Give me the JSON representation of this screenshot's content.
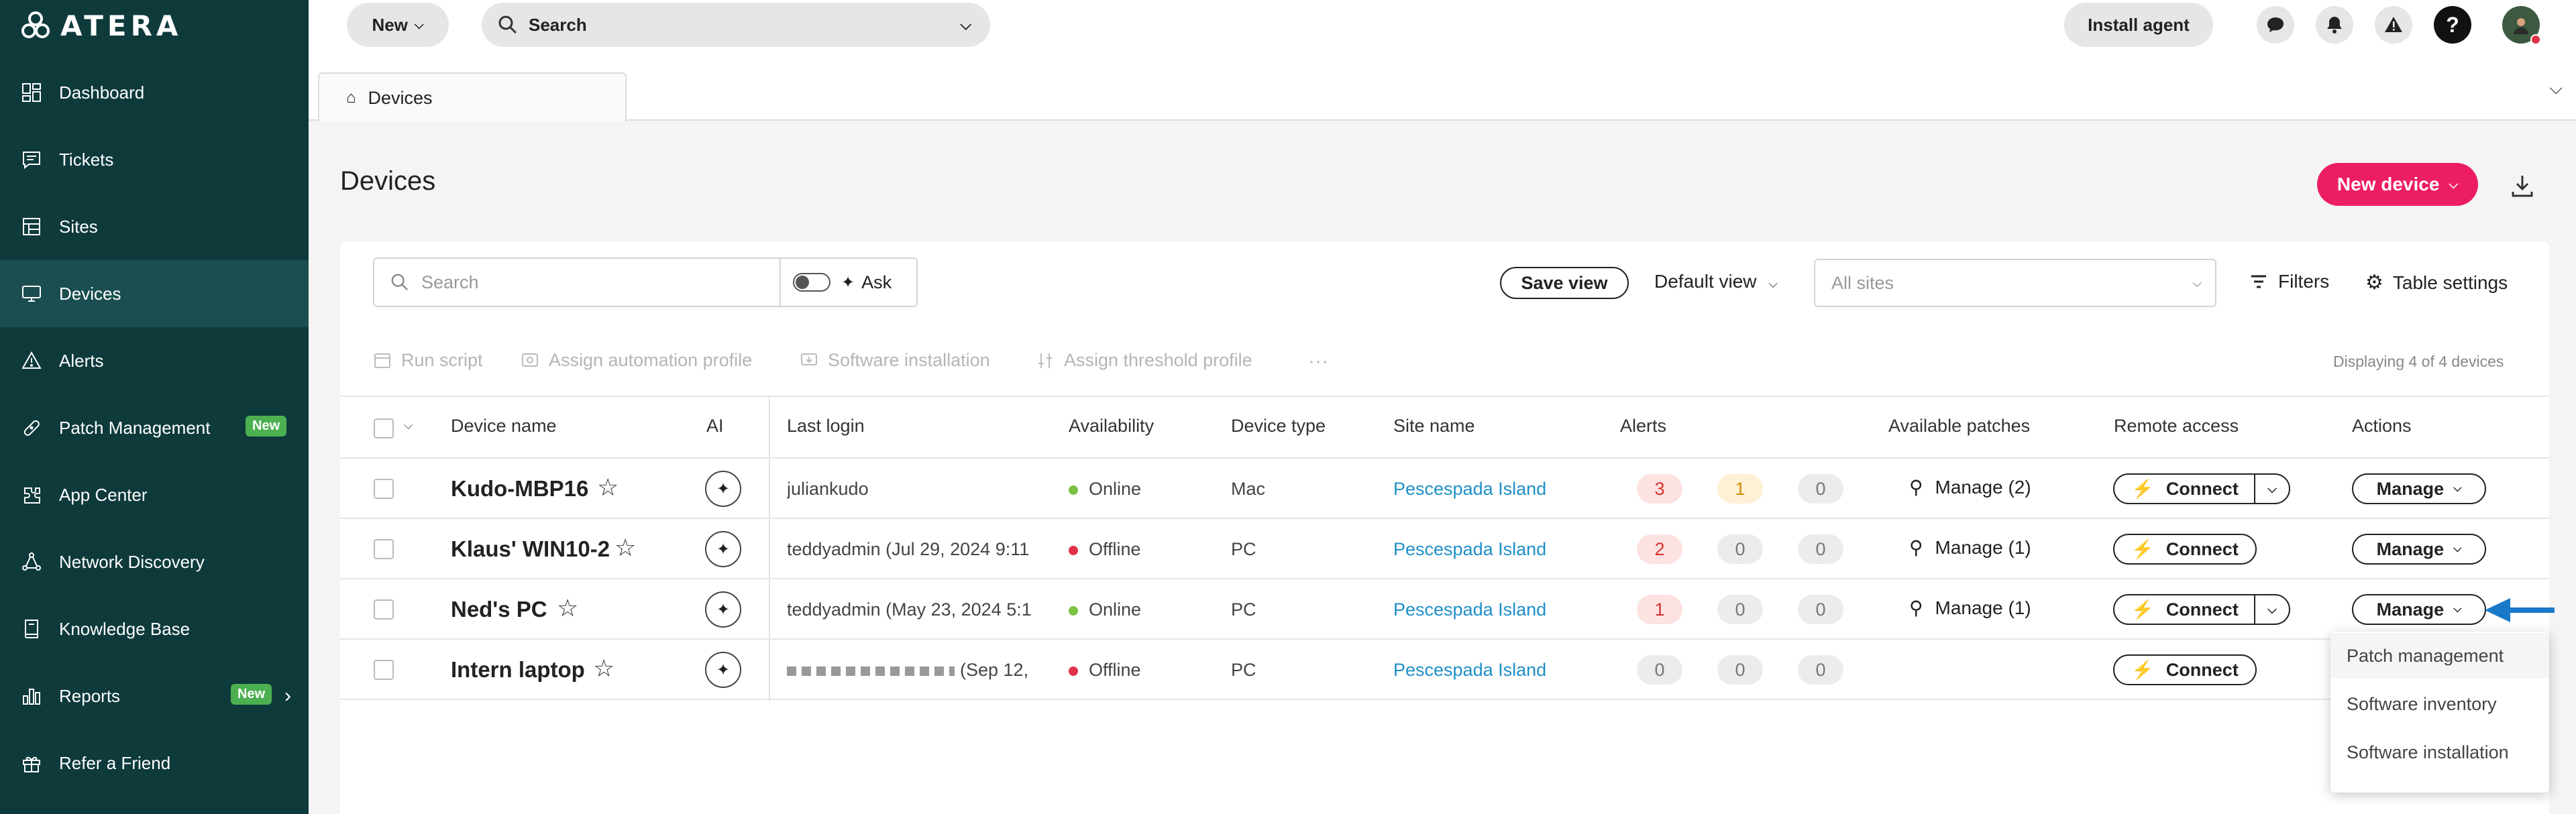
{
  "app": {
    "brand": "ATERA"
  },
  "sidebar": {
    "items": [
      {
        "label": "Dashboard",
        "icon": "dashboard-icon"
      },
      {
        "label": "Tickets",
        "icon": "tickets-icon"
      },
      {
        "label": "Sites",
        "icon": "sites-icon"
      },
      {
        "label": "Devices",
        "icon": "devices-icon",
        "active": true
      },
      {
        "label": "Alerts",
        "icon": "alert-icon"
      },
      {
        "label": "Patch Management",
        "icon": "patch-icon",
        "badge": "New"
      },
      {
        "label": "App Center",
        "icon": "app-center-icon"
      },
      {
        "label": "Network Discovery",
        "icon": "network-icon"
      },
      {
        "label": "Knowledge Base",
        "icon": "book-icon"
      },
      {
        "label": "Reports",
        "icon": "reports-icon",
        "badge": "New"
      },
      {
        "label": "Refer a Friend",
        "icon": "gift-icon"
      }
    ]
  },
  "topbar": {
    "new_label": "New",
    "search_label": "Search",
    "install_agent_label": "Install agent"
  },
  "tabs": {
    "devices_label": "Devices"
  },
  "main": {
    "title": "Devices",
    "new_device_label": "New device",
    "toolbar": {
      "search_placeholder": "Search",
      "ask_label": "Ask",
      "save_view_label": "Save view",
      "default_view_label": "Default view",
      "sites_placeholder": "All sites",
      "filters_label": "Filters",
      "table_settings_label": "Table settings"
    },
    "actions": {
      "run_script": "Run script",
      "assign_automation": "Assign automation profile",
      "software_installation": "Software installation",
      "assign_threshold": "Assign threshold profile",
      "more": "···",
      "displaying": "Displaying 4 of 4 devices"
    },
    "columns": {
      "device_name": "Device name",
      "ai": "AI",
      "last_login": "Last login",
      "availability": "Availability",
      "device_type": "Device type",
      "site_name": "Site name",
      "alerts": "Alerts",
      "available_patches": "Available patches",
      "remote_access": "Remote access",
      "actions": "Actions"
    },
    "rows": [
      {
        "name": "Kudo-MBP16",
        "last_login": "juliankudo",
        "availability": "Online",
        "type": "Mac",
        "site": "Pescespada Island",
        "alerts": [
          "3",
          "1",
          "0"
        ],
        "patches": "Manage (2)",
        "connect": "Connect",
        "manage": "Manage"
      },
      {
        "name": "Klaus' WIN10-2",
        "last_login": "teddyadmin (Jul 29, 2024 9:11",
        "availability": "Offline",
        "type": "PC",
        "site": "Pescespada Island",
        "alerts": [
          "2",
          "0",
          "0"
        ],
        "patches": "Manage (1)",
        "connect": "Connect",
        "manage": "Manage"
      },
      {
        "name": "Ned's PC",
        "last_login": "teddyadmin (May 23, 2024 5:1",
        "availability": "Online",
        "type": "PC",
        "site": "Pescespada Island",
        "alerts": [
          "1",
          "0",
          "0"
        ],
        "patches": "Manage (1)",
        "connect": "Connect",
        "manage": "Manage"
      },
      {
        "name": "Intern laptop",
        "last_login": "(Sep 12,",
        "availability": "Offline",
        "type": "PC",
        "site": "Pescespada Island",
        "alerts": [
          "0",
          "0",
          "0"
        ],
        "patches": "",
        "connect": "Connect",
        "manage": ""
      }
    ],
    "manage_menu": [
      "Patch management",
      "Software inventory",
      "Software installation"
    ]
  },
  "colors": {
    "sidebar": "#0e3a3c",
    "accent": "#ec1d63",
    "link": "#1f8fc7",
    "online": "#7cc242",
    "offline": "#e0324b"
  }
}
